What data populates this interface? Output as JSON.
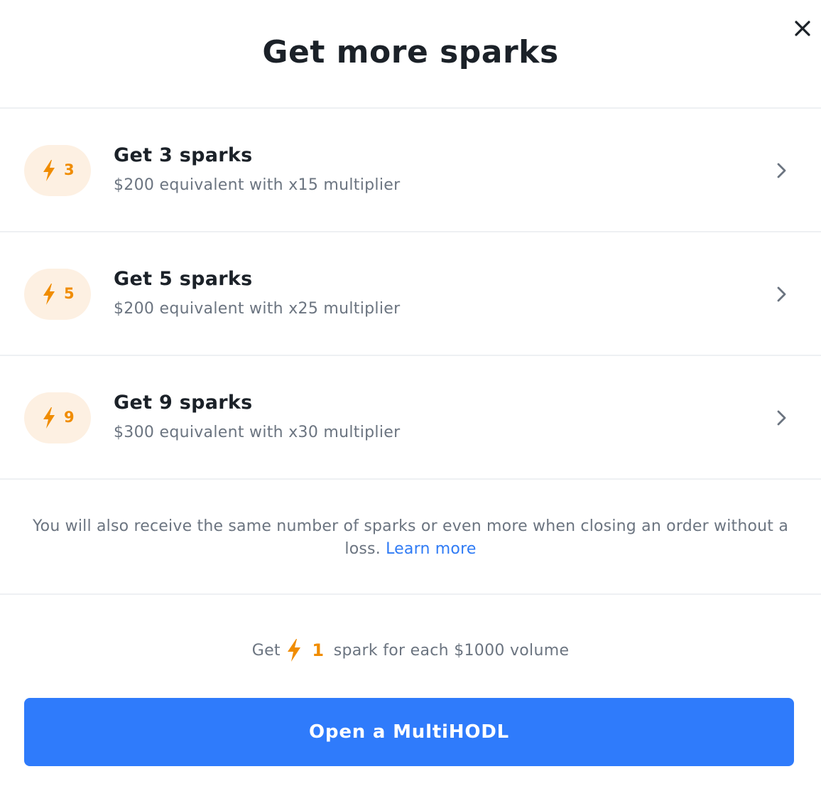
{
  "dialog": {
    "title": "Get more sparks",
    "close_icon": "close-icon"
  },
  "options": [
    {
      "badge_count": "3",
      "title": "Get 3 sparks",
      "subtitle": "$200 equivalent with x15 multiplier",
      "icon": "lightning-icon"
    },
    {
      "badge_count": "5",
      "title": "Get 5 sparks",
      "subtitle": "$200 equivalent with x25 multiplier",
      "icon": "lightning-icon"
    },
    {
      "badge_count": "9",
      "title": "Get 9 sparks",
      "subtitle": "$300 equivalent with x30 multiplier",
      "icon": "lightning-icon"
    }
  ],
  "info": {
    "text": "You will also receive the same number of sparks or even more when closing an order without a loss.",
    "link_label": "Learn more"
  },
  "volume_note": {
    "prefix": "Get",
    "count": "1",
    "suffix": "spark for each $1000 volume",
    "icon": "lightning-icon"
  },
  "cta": {
    "label": "Open a MultiHODL"
  },
  "colors": {
    "accent_blue": "#2f7bfb",
    "spark_orange": "#f08c00",
    "badge_bg": "#fdf0e2",
    "text_primary": "#1b2128",
    "text_secondary": "#6b7480",
    "divider": "#eef0f3"
  }
}
